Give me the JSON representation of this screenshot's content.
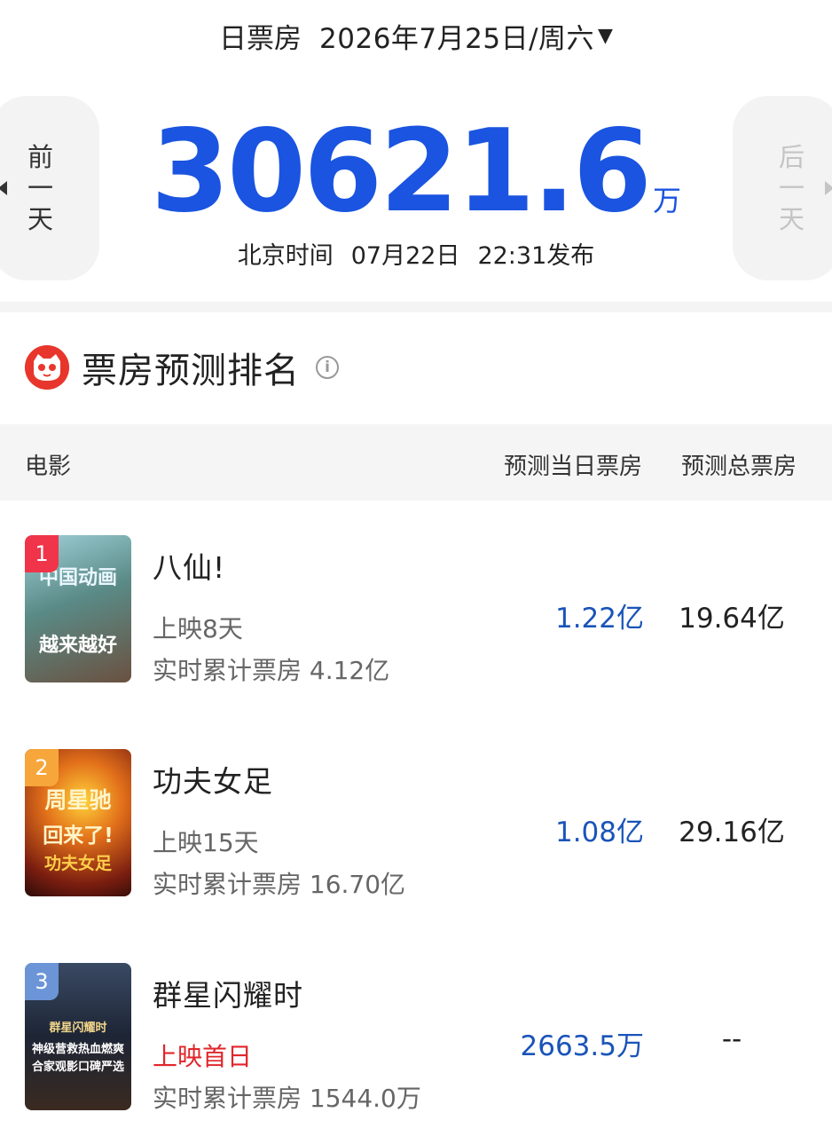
{
  "header": {
    "label": "日票房",
    "date": "2026年7月25日/周六",
    "caret": "▼"
  },
  "nav": {
    "prev": [
      "前",
      "一",
      "天"
    ],
    "next": [
      "后",
      "一",
      "天"
    ]
  },
  "summary": {
    "value": "30621.6",
    "unit": "万",
    "tz": "北京时间",
    "pub_date": "07月22日",
    "pub_time": "22:31发布"
  },
  "section": {
    "title": "票房预测排名",
    "info_glyph": "i"
  },
  "table": {
    "col_movie": "电影",
    "col_today": "预测当日票房",
    "col_total": "预测总票房"
  },
  "movies": [
    {
      "rank": "1",
      "title": "八仙!",
      "days": "上映8天",
      "realtime": "实时累计票房 4.12亿",
      "today": "1.22亿",
      "total": "19.64亿",
      "poster_lines": [
        "中国动画",
        "越来越好"
      ],
      "rank_color": "#f0344a"
    },
    {
      "rank": "2",
      "title": "功夫女足",
      "days": "上映15天",
      "realtime": "实时累计票房 16.70亿",
      "today": "1.08亿",
      "total": "29.16亿",
      "poster_lines": [
        "周星驰",
        "回来了!",
        "功夫女足"
      ],
      "rank_color": "#f6a63a"
    },
    {
      "rank": "3",
      "title": "群星闪耀时",
      "days": "上映首日",
      "realtime": "实时累计票房 1544.0万",
      "today": "2663.5万",
      "total": "--",
      "poster_lines": [
        "群星闪耀时",
        "神级营救热血燃爽",
        "合家观影口碑严选"
      ],
      "rank_color": "#6b95d6"
    }
  ]
}
